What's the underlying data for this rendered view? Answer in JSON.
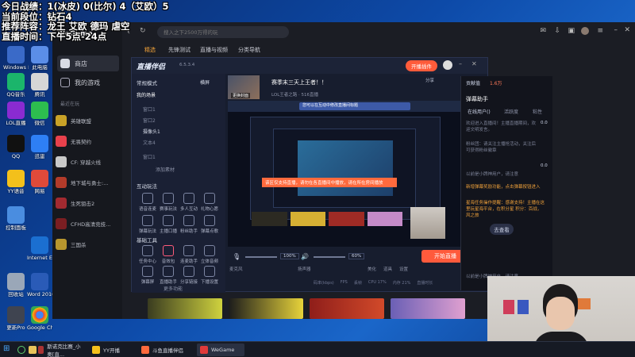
{
  "overlay": {
    "line1": "今日战绩：1(冰皮) 0(比尔) 4（艾欧）5",
    "line2": "当前段位：钻石4",
    "line3": "推荐阵容：龙王 艾欧 德玛 虐空",
    "line4": "直播时间：下午5点-24点"
  },
  "desktop": {
    "icons": [
      {
        "label": "Windows Media"
      },
      {
        "label": "此电脑"
      },
      {
        "label": "QQ音乐"
      },
      {
        "label": "腾讯"
      },
      {
        "label": "LOL直播"
      },
      {
        "label": "微信"
      },
      {
        "label": "QQ"
      },
      {
        "label": "迅雷"
      },
      {
        "label": "YY语音"
      },
      {
        "label": "网易"
      },
      {
        "label": "控制面板"
      },
      {
        "label": "Internet Explorer"
      },
      {
        "label": "Word 2010"
      },
      {
        "label": "Google Chrome"
      },
      {
        "label": "更新Pro"
      },
      {
        "label": "回收站"
      }
    ]
  },
  "wegame": {
    "logo_text": "WeGame",
    "search_placeholder": "搜入之下2500万得的玩",
    "nav": [
      "精选",
      "先锋测试",
      "直播与视频",
      "分类导航"
    ],
    "side": {
      "store": "商店",
      "games": "我的游戏",
      "recent": "最近在玩",
      "game_list": [
        "英雄联盟",
        "无畏契约",
        "CF: 穿越火线",
        "地下城与勇士:...",
        "生死狙击2",
        "CFHD高清竞技...",
        "三国杀"
      ]
    }
  },
  "live": {
    "app_title": "直播伴侣",
    "version": "6.5.3.4",
    "stream_title": "赛季末三天上王者！！",
    "cover_btn": "更换封面",
    "start_btn": "开始直播",
    "open_plugin": "开播插件",
    "share": "分享",
    "room_tip": "LOL王者之路 · 516直播",
    "mode_label": "常规模式",
    "horizontal": "横屏",
    "tab_my": "我的场景",
    "src1": "窗口1",
    "src2": "窗口2",
    "src3": "摄像头1",
    "src4": "文本4",
    "add_source": "添加素材",
    "interact": "互动玩法",
    "basic_tools": "基础工具",
    "more": "更多功能",
    "tools1": [
      "语音连麦",
      "赛事玩法",
      "多人互动",
      "礼物心愿"
    ],
    "tools2": [
      "弹幕玩法",
      "主播口播",
      "粉丝助手",
      "弹幕点歌"
    ],
    "tools3": [
      "任务中心",
      "音效包",
      "连麦助手",
      "立体音频"
    ],
    "tools4": [
      "弹幕屏",
      "直播助手",
      "分享链接",
      "下播设置"
    ],
    "warning": "该区仅支持直播，请勿在各直播间中播放，请在所在房间播放",
    "tip_blue": "您可以在互动中修改直播间标题",
    "stats": {
      "bitrate_label": "码率(kbps)",
      "fps_label": "FPS",
      "drop_label": "丢帧",
      "cpu": "CPU 17%",
      "mem": "内存 21%",
      "net": "丢帧 0%",
      "duration": "直播时长"
    },
    "mic_label": "麦克风",
    "speaker_label": "扬声器",
    "mic_pct": "100%",
    "spk_pct": "60%",
    "setting": "设置",
    "sound": "美化",
    "props": "道具"
  },
  "rpanel": {
    "level": "贡献值",
    "count": "1.6万",
    "title": "弹幕助手",
    "tabs": [
      "在线用户()",
      "活跃度",
      "粘性"
    ],
    "msg1": "欢迎进入直播间！主播直播期间，欢迎文明发言。",
    "msg2": "粉丝团：请关注主播抢活动，关注后可获得粉丝徽章",
    "gift_tip": "新增弹幕奖励功能，点击弹幕按钮进入",
    "tip2": "星海任务操作提醒：感谢支持！主播在这里玩星海平台，在积分星 积分：百战，风之旅",
    "check": "去查看",
    "welcome": "以前是小牌神用户，请注意",
    "num1": "0.0",
    "num2": "0.0"
  },
  "taskbar": {
    "items": [
      "斯诺克比赛_小奥[直...",
      "YY开播",
      "斗鱼直播伴侣",
      "WeGame"
    ]
  }
}
